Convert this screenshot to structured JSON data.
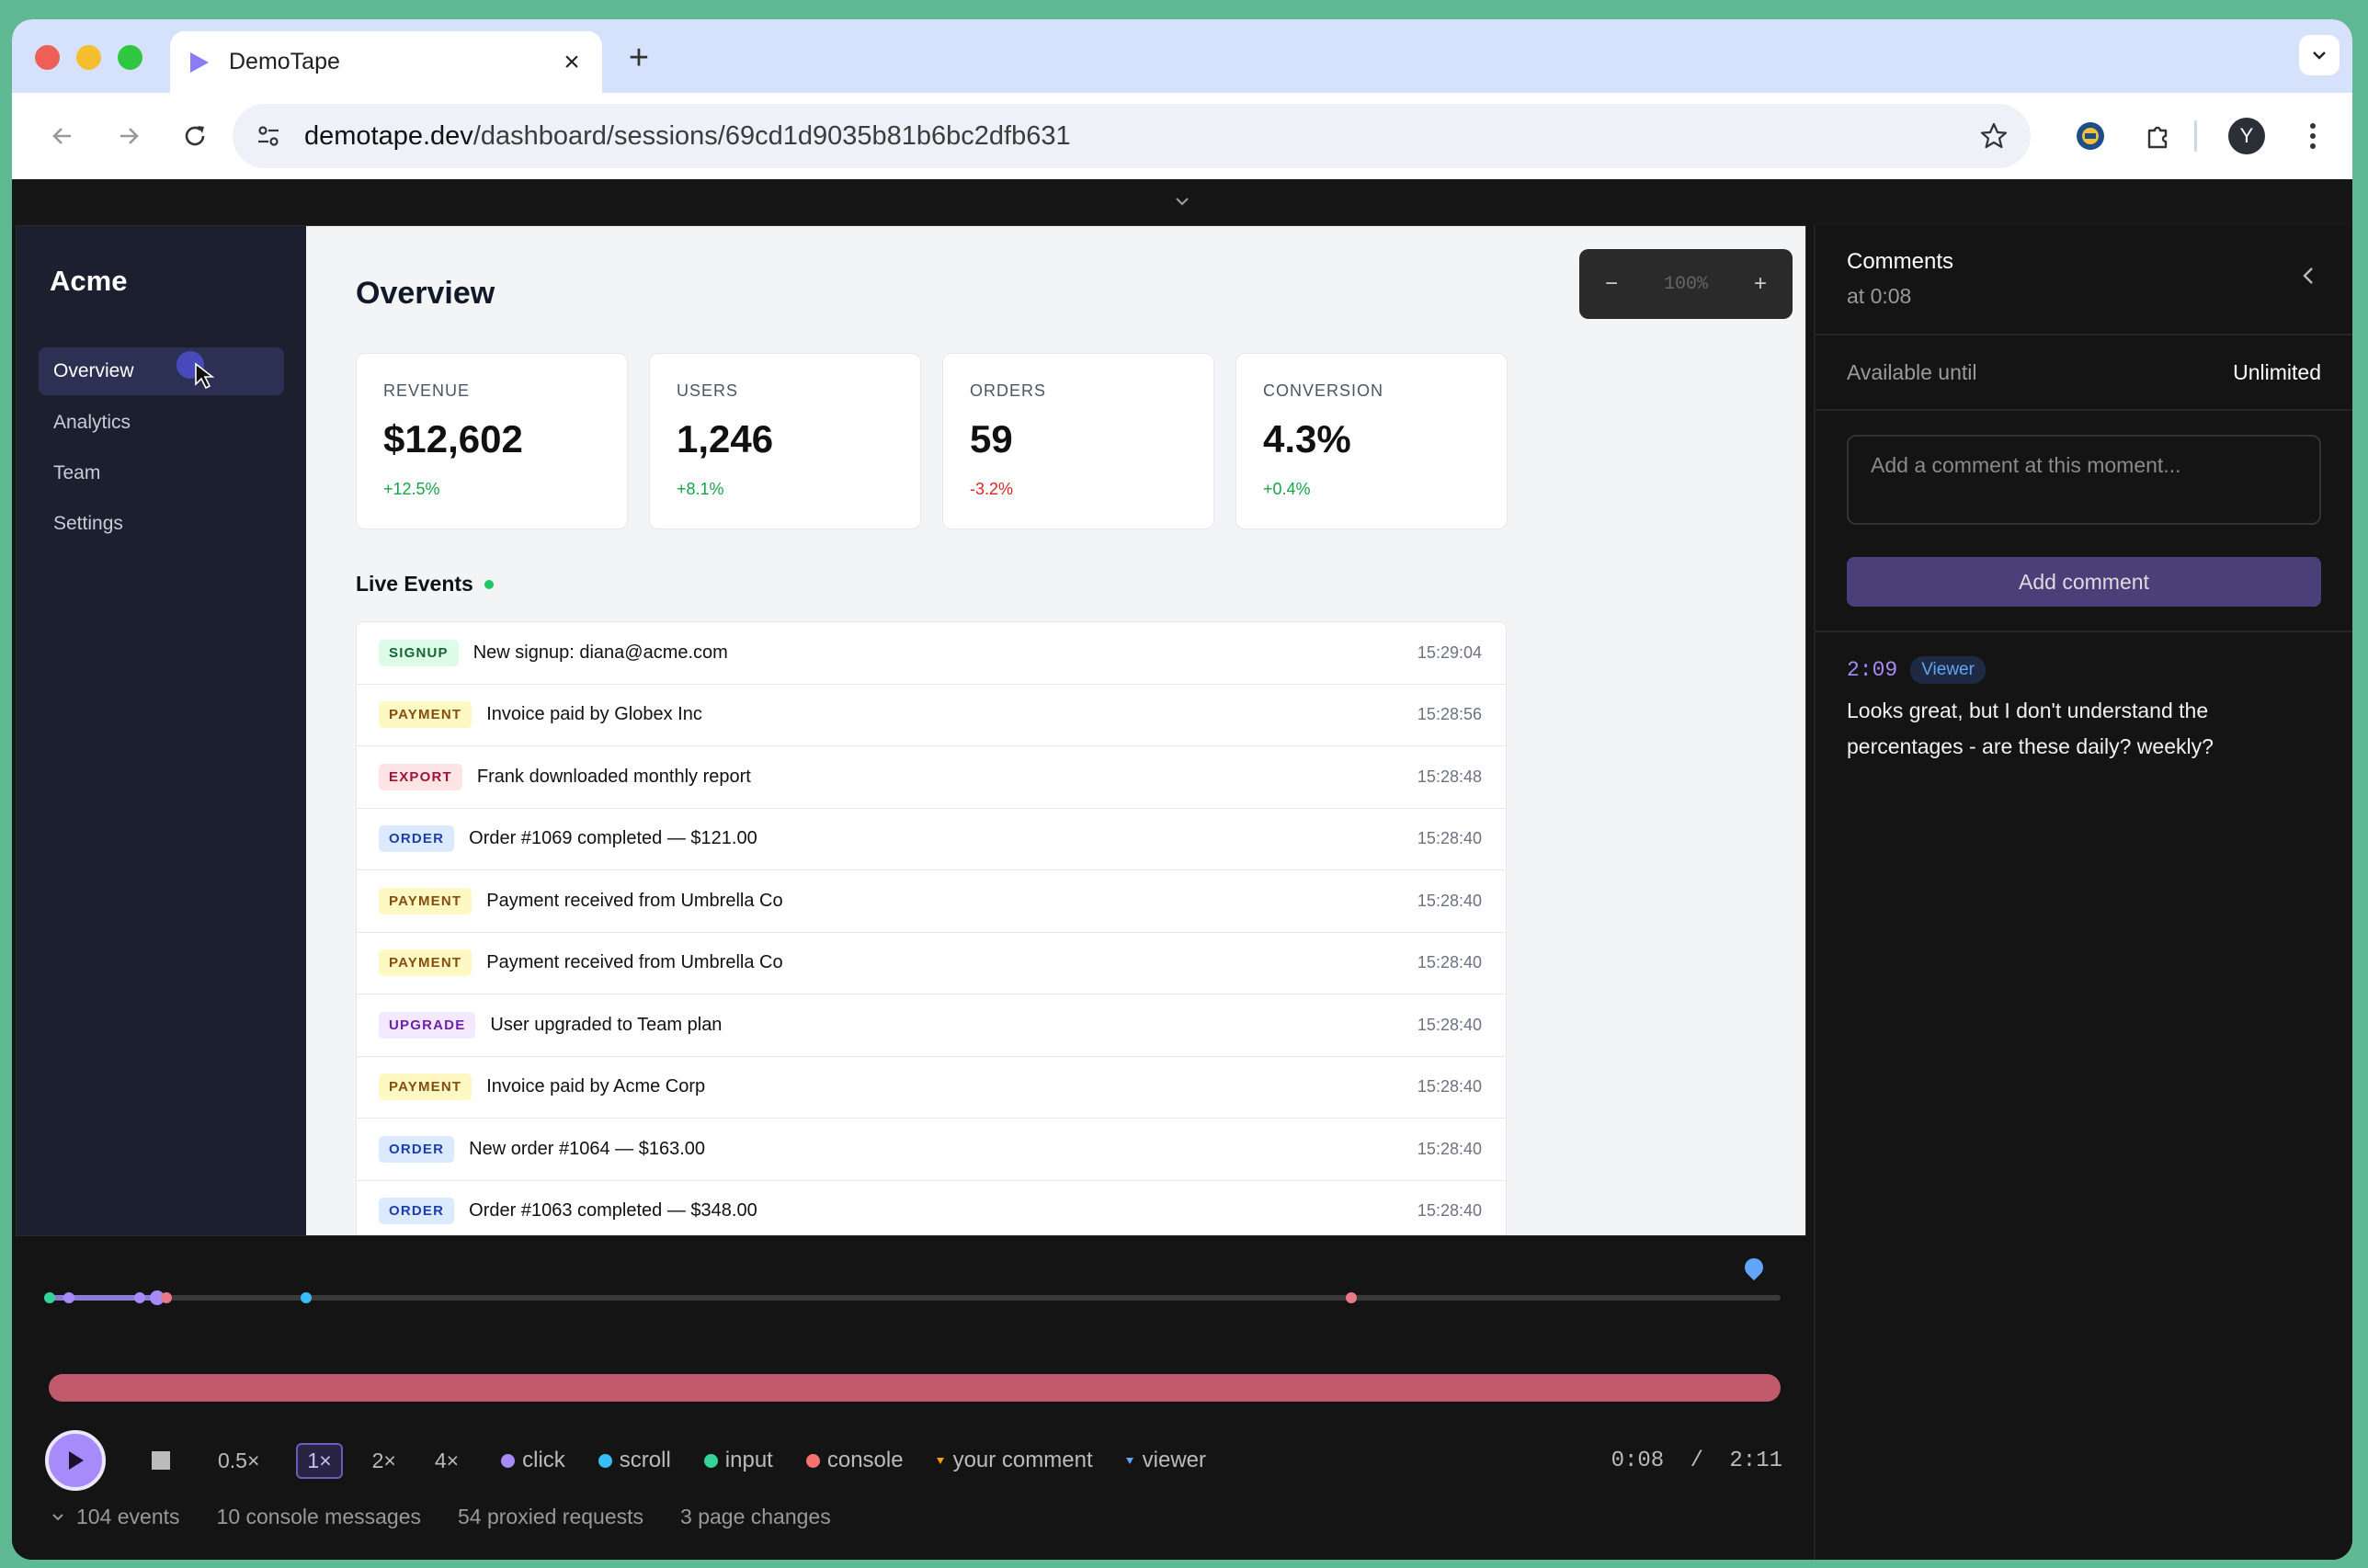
{
  "browser": {
    "tab_title": "DemoTape",
    "url_host": "demotape.dev",
    "url_path": "/dashboard/sessions/69cd1d9035b81b6bc2dfb631",
    "profile_initial": "Y"
  },
  "app": {
    "brand": "Acme",
    "nav": [
      {
        "label": "Overview",
        "active": true
      },
      {
        "label": "Analytics",
        "active": false
      },
      {
        "label": "Team",
        "active": false
      },
      {
        "label": "Settings",
        "active": false
      }
    ],
    "page_title": "Overview",
    "zoom": {
      "minus": "−",
      "value": "100%",
      "plus": "+"
    },
    "metrics": [
      {
        "label": "REVENUE",
        "value": "$12,602",
        "delta": "+12.5%",
        "trend": "up"
      },
      {
        "label": "USERS",
        "value": "1,246",
        "delta": "+8.1%",
        "trend": "up"
      },
      {
        "label": "ORDERS",
        "value": "59",
        "delta": "-3.2%",
        "trend": "down"
      },
      {
        "label": "CONVERSION",
        "value": "4.3%",
        "delta": "+0.4%",
        "trend": "up"
      }
    ],
    "live_events_title": "Live Events",
    "events": [
      {
        "type": "SIGNUP",
        "text": "New signup: diana@acme.com",
        "time": "15:29:04"
      },
      {
        "type": "PAYMENT",
        "text": "Invoice paid by Globex Inc",
        "time": "15:28:56"
      },
      {
        "type": "EXPORT",
        "text": "Frank downloaded monthly report",
        "time": "15:28:48"
      },
      {
        "type": "ORDER",
        "text": "Order #1069 completed — $121.00",
        "time": "15:28:40"
      },
      {
        "type": "PAYMENT",
        "text": "Payment received from Umbrella Co",
        "time": "15:28:40"
      },
      {
        "type": "PAYMENT",
        "text": "Payment received from Umbrella Co",
        "time": "15:28:40"
      },
      {
        "type": "UPGRADE",
        "text": "User upgraded to Team plan",
        "time": "15:28:40"
      },
      {
        "type": "PAYMENT",
        "text": "Invoice paid by Acme Corp",
        "time": "15:28:40"
      },
      {
        "type": "ORDER",
        "text": "New order #1064 — $163.00",
        "time": "15:28:40"
      },
      {
        "type": "ORDER",
        "text": "Order #1063 completed — $348.00",
        "time": "15:28:40"
      }
    ],
    "badge_colors": {
      "SIGNUP": {
        "fg": "#166534",
        "bg": "#dcfce7"
      },
      "PAYMENT": {
        "fg": "#854d0e",
        "bg": "#fef9c3"
      },
      "EXPORT": {
        "fg": "#9f1239",
        "bg": "#ffe4e6"
      },
      "ORDER": {
        "fg": "#1e40af",
        "bg": "#dbeafe"
      },
      "UPGRADE": {
        "fg": "#6b21a8",
        "bg": "#f3e8ff"
      }
    }
  },
  "comments": {
    "title": "Comments",
    "subtitle": "at 0:08",
    "available_label": "Available until",
    "available_value": "Unlimited",
    "input_placeholder": "Add a comment at this moment...",
    "add_button": "Add comment",
    "items": [
      {
        "time": "2:09",
        "role": "Viewer",
        "text": "Looks great, but I don't understand the percentages - are these daily? weekly?"
      }
    ]
  },
  "player": {
    "speeds": [
      "0.5×",
      "1×",
      "2×",
      "4×"
    ],
    "active_speed": "1×",
    "legend": [
      {
        "label": "click",
        "color": "#a78bfa",
        "shape": "dot"
      },
      {
        "label": "scroll",
        "color": "#38bdf8",
        "shape": "dot"
      },
      {
        "label": "input",
        "color": "#34d399",
        "shape": "dot"
      },
      {
        "label": "console",
        "color": "#f87171",
        "shape": "dot"
      },
      {
        "label": "your comment",
        "color": "#f59e0b",
        "shape": "tri"
      },
      {
        "label": "viewer",
        "color": "#60a5fa",
        "shape": "tri"
      }
    ],
    "current_time": "0:08",
    "separator": "/",
    "total_time": "2:11",
    "progress_seconds": 8,
    "duration_seconds": 131,
    "event_markers": [
      {
        "t": 0.1,
        "kind": "input"
      },
      {
        "t": 1.5,
        "kind": "click"
      },
      {
        "t": 6.9,
        "kind": "click"
      },
      {
        "t": 8.2,
        "kind": "click"
      },
      {
        "t": 8.9,
        "kind": "console"
      },
      {
        "t": 19.5,
        "kind": "scroll"
      },
      {
        "t": 98.5,
        "kind": "console"
      }
    ],
    "viewer_pin_seconds": 129,
    "stats": [
      "104 events",
      "10 console messages",
      "54 proxied requests",
      "3 page changes"
    ]
  }
}
